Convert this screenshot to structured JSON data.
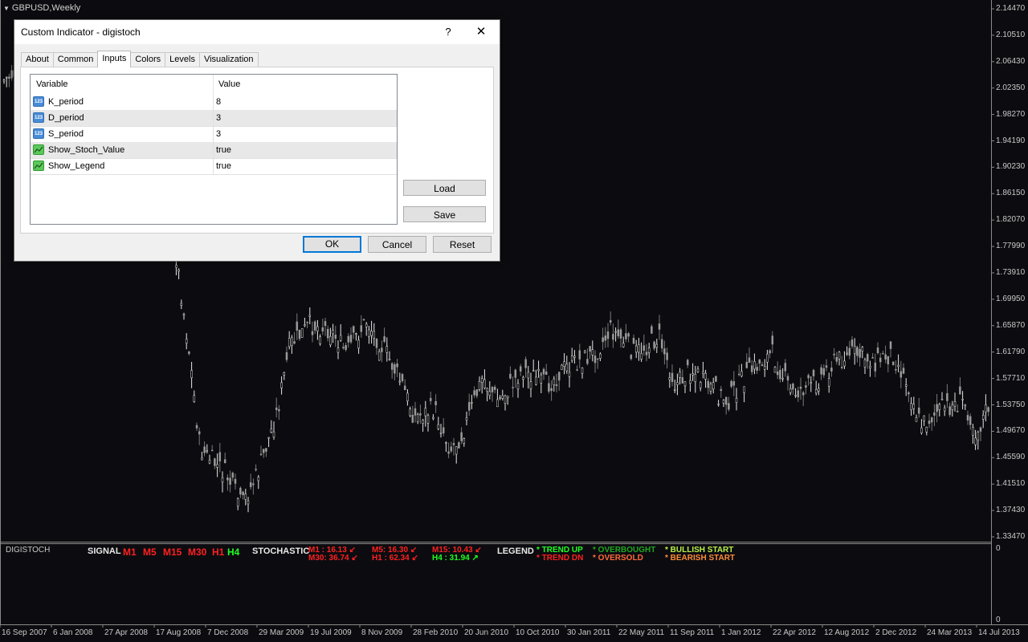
{
  "chart": {
    "symbol_title": "GBPUSD,Weekly",
    "price_axis": [
      "2.14470",
      "2.10510",
      "2.06430",
      "2.02350",
      "1.98270",
      "1.94190",
      "1.90230",
      "1.86150",
      "1.82070",
      "1.77990",
      "1.73910",
      "1.69950",
      "1.65870",
      "1.61790",
      "1.57710",
      "1.53750",
      "1.49670",
      "1.45590",
      "1.41510",
      "1.37430",
      "1.33470"
    ],
    "subwindow_axis": [
      "0",
      "0"
    ],
    "date_axis": [
      "16 Sep 2007",
      "6 Jan 2008",
      "27 Apr 2008",
      "17 Aug 2008",
      "7 Dec 2008",
      "29 Mar 2009",
      "19 Jul 2009",
      "8 Nov 2009",
      "28 Feb 2010",
      "20 Jun 2010",
      "10 Oct 2010",
      "30 Jan 2011",
      "22 May 2011",
      "11 Sep 2011",
      "1 Jan 2012",
      "22 Apr 2012",
      "12 Aug 2012",
      "2 Dec 2012",
      "24 Mar 2013",
      "14 Jul 2013"
    ]
  },
  "indicator": {
    "name": "DIGISTOCH",
    "signal_label": "SIGNAL",
    "timeframes": [
      {
        "tf": "M1",
        "color": "#ff2020"
      },
      {
        "tf": "M5",
        "color": "#ff2020"
      },
      {
        "tf": "M15",
        "color": "#ff2020"
      },
      {
        "tf": "M30",
        "color": "#ff2020"
      },
      {
        "tf": "H1",
        "color": "#ff2020"
      },
      {
        "tf": "H4",
        "color": "#20ff20"
      }
    ],
    "stochastic_label": "STOCHASTIC",
    "stoch_values": [
      {
        "text": "M1  : 16.13",
        "color": "#ff2020"
      },
      {
        "text": "M5: 16.30",
        "color": "#ff2020"
      },
      {
        "text": "M15: 10.43",
        "color": "#ff2020"
      },
      {
        "text": "M30: 36.74",
        "color": "#ff2020"
      },
      {
        "text": "H1  : 62.34",
        "color": "#ff2020"
      },
      {
        "text": "H4  : 31.94",
        "color": "#20ff20"
      }
    ],
    "legend_label": "LEGEND",
    "legend": [
      {
        "text": "* TREND UP",
        "color": "#20ff20"
      },
      {
        "text": "* TREND DN",
        "color": "#ff2020"
      },
      {
        "text": "* OVERBOUGHT",
        "color": "#1fa81f"
      },
      {
        "text": "* OVERSOLD",
        "color": "#ff6a3a"
      },
      {
        "text": "* BULLISH START",
        "color": "#b8f048"
      },
      {
        "text": "* BEARISH START",
        "color": "#ff8c3a"
      }
    ],
    "colors": {
      "up": "#20ff20",
      "down": "#ff2020",
      "label": "#e8e8e8"
    }
  },
  "dialog": {
    "title": "Custom Indicator - digistoch",
    "help_glyph": "?",
    "close_glyph": "✕",
    "tabs": [
      "About",
      "Common",
      "Inputs",
      "Colors",
      "Levels",
      "Visualization"
    ],
    "active_tab": "Inputs",
    "grid": {
      "headers": [
        "Variable",
        "Value"
      ],
      "rows": [
        {
          "icon": "numeric-icon",
          "icon_text": "123",
          "name": "K_period",
          "value": "8"
        },
        {
          "icon": "numeric-icon",
          "icon_text": "123",
          "name": "D_period",
          "value": "3"
        },
        {
          "icon": "numeric-icon",
          "icon_text": "123",
          "name": "S_period",
          "value": "3"
        },
        {
          "icon": "boolean-icon",
          "icon_text": "",
          "name": "Show_Stoch_Value",
          "value": "true"
        },
        {
          "icon": "boolean-icon",
          "icon_text": "",
          "name": "Show_Legend",
          "value": "true"
        }
      ]
    },
    "buttons": {
      "load": "Load",
      "save": "Save",
      "ok": "OK",
      "cancel": "Cancel",
      "reset": "Reset"
    }
  }
}
